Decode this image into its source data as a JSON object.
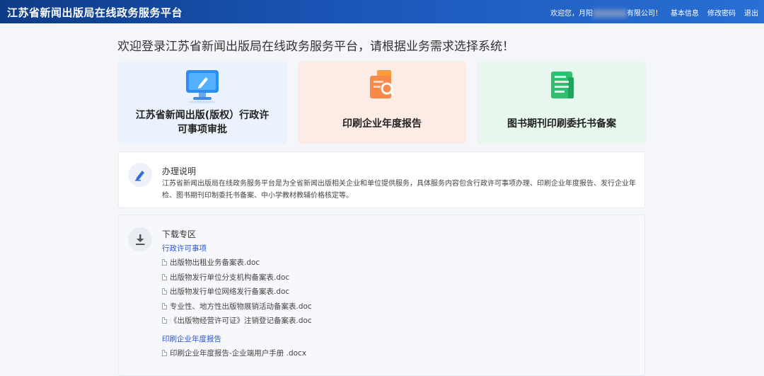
{
  "header": {
    "title": "江苏省新闻出版局在线政务服务平台",
    "greeting": "欢迎您，月阳",
    "company_suffix": "有限公司！",
    "basic_info": "基本信息",
    "change_password": "修改密码",
    "logout": "退出"
  },
  "welcome": "欢迎登录江苏省新闻出版局在线政务服务平台，请根据业务需求选择系统！",
  "cards": [
    {
      "label": "江苏省新闻出版(版权）行政许可事项审批",
      "icon": "monitor-pen-icon"
    },
    {
      "label": "印刷企业年度报告",
      "icon": "document-search-icon"
    },
    {
      "label": "图书期刊印刷委托书备案",
      "icon": "document-list-icon"
    }
  ],
  "info": {
    "title": "办理说明",
    "icon": "pen-icon",
    "text": "江苏省新闻出版局在线政务服务平台是为全省新闻出版相关企业和单位提供服务，具体服务内容包含行政许可事项办理、印刷企业年度报告、发行企业年检、图书期刊印制委托书备案、中小学教材教辅价格核定等。"
  },
  "download": {
    "title": "下载专区",
    "icon": "download-icon",
    "sections": [
      {
        "title": "行政许可事项",
        "files": [
          "出版物出租业务备案表.doc",
          "出版物发行单位分支机构备案表.doc",
          "出版物发行单位网络发行备案表.doc",
          "专业性、地方性出版物展销活动备案表.doc",
          "《出版物经营许可证》注销登记备案表.doc"
        ]
      },
      {
        "title": "印刷企业年度报告",
        "files": [
          "印刷企业年度报告-企业端用户手册 .docx"
        ]
      }
    ]
  },
  "colors": {
    "header_start": "#0f3b86",
    "header_end": "#2a6fd4",
    "section_link": "#2f54c7",
    "card1_bg": "#eaf2fd",
    "card2_bg": "#fdece6",
    "card3_bg": "#e7f7ee"
  }
}
